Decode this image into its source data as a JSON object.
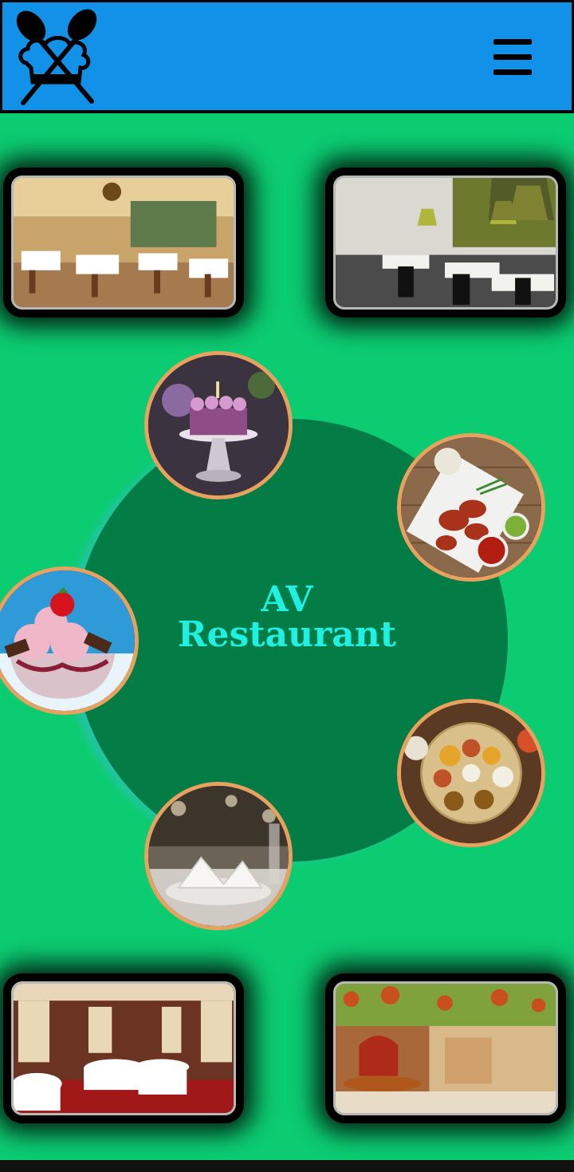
{
  "header": {
    "logo_icon": "chef-hat-crossed-spoons-logo",
    "menu_icon": "hamburger-menu-icon",
    "bg_color": "#1192e8"
  },
  "hero": {
    "title_line1": "AV",
    "title_line2": "Restaurant",
    "title_color": "#1ff0e4",
    "hub_color": "#037c45"
  },
  "gallery": {
    "top_left": "restaurant-interior-image",
    "top_right": "modern-dining-hall-image",
    "bottom_left": "fine-dining-room-image",
    "bottom_right": "courtyard-restaurant-image"
  },
  "dishes": [
    "cake-image",
    "tandoori-platter-image",
    "ice-cream-image",
    "thali-image",
    "table-setting-image"
  ],
  "colors": {
    "page_bg": "#0ccc72",
    "orb_border": "#e8a15e"
  }
}
